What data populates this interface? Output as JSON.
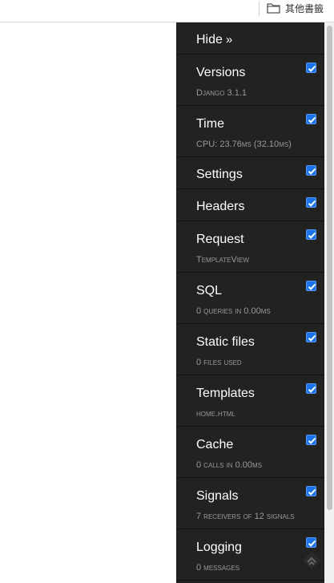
{
  "bookmarks": {
    "other_label": "其他書籤",
    "icon": "folder-icon"
  },
  "toolbar": {
    "hide_label": "Hide",
    "hide_glyph": "»",
    "panels": [
      {
        "id": "versions",
        "title": "Versions",
        "subtitle": "Django 3.1.1",
        "checked": true
      },
      {
        "id": "time",
        "title": "Time",
        "subtitle": "CPU: 23.76ms (32.10ms)",
        "checked": true
      },
      {
        "id": "settings",
        "title": "Settings",
        "subtitle": "",
        "checked": true
      },
      {
        "id": "headers",
        "title": "Headers",
        "subtitle": "",
        "checked": true
      },
      {
        "id": "request",
        "title": "Request",
        "subtitle": "TemplateView",
        "checked": true
      },
      {
        "id": "sql",
        "title": "SQL",
        "subtitle": "0 queries in 0.00ms",
        "checked": true
      },
      {
        "id": "static-files",
        "title": "Static files",
        "subtitle": "0 files used",
        "checked": true
      },
      {
        "id": "templates",
        "title": "Templates",
        "subtitle": "home.html",
        "checked": true
      },
      {
        "id": "cache",
        "title": "Cache",
        "subtitle": "0 calls in 0.00ms",
        "checked": true
      },
      {
        "id": "signals",
        "title": "Signals",
        "subtitle": "7 receivers of 12 signals",
        "checked": true
      },
      {
        "id": "logging",
        "title": "Logging",
        "subtitle": "0 messages",
        "checked": true
      }
    ]
  },
  "colors": {
    "panel_bg": "#222222",
    "checkbox": "#1a73e8",
    "subtitle": "#999999"
  }
}
